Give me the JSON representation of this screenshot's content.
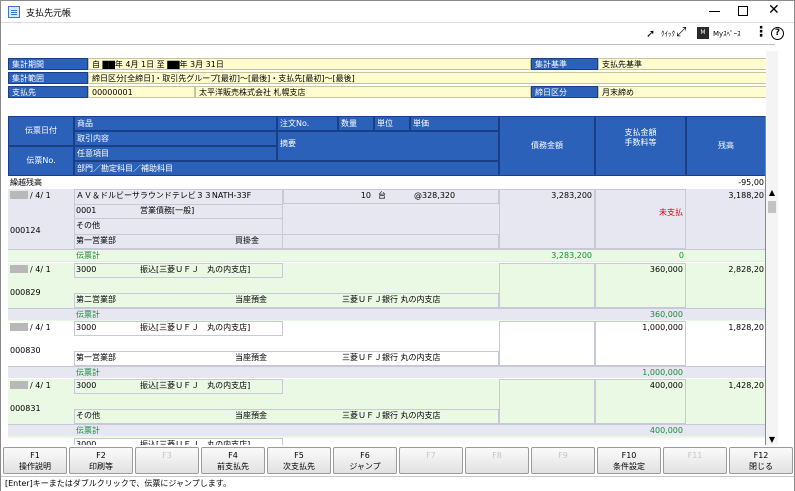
{
  "window": {
    "title": "支払先元帳"
  },
  "toolbar": {
    "quick_label": "ｸｲｯｸ",
    "myspace_label": "Myｽﾍﾟｰｽ",
    "help_label": "?"
  },
  "header": {
    "period_label": "集計期間",
    "period_value": "自 ▇▇年 4月 1日 至 ▇▇年 3月 31日",
    "basis_label": "集計基準",
    "basis_value": "支払先基準",
    "range_label": "集計範囲",
    "range_value": "締日区分[全締日]・取引先グループ[最初]～[最後]・支払先[最初]～[最後]",
    "payee_label": "支払先",
    "payee_code": "00000001",
    "payee_name": "太平洋販売株式会社 札幌支店",
    "closing_label": "締日区分",
    "closing_value": "月末締め"
  },
  "columns": {
    "slip_date": "伝票日付",
    "slip_no": "伝票No.",
    "product": "商品",
    "transaction": "取引内容",
    "optional": "任意項目",
    "dept": "部門／勘定科目／補助科目",
    "order_no": "注文No.",
    "qty": "数量",
    "unit": "単位",
    "unit_price": "単価",
    "memo": "摘要",
    "debt": "債務金額",
    "pay_line1": "支払金額",
    "pay_line2": "手数料等",
    "balance": "残高"
  },
  "carry": {
    "label": "繰越残高",
    "balance": "-95,00"
  },
  "subtotal_label": "伝票計",
  "unpaid_label": "未支払",
  "entries": [
    {
      "date": "/ 4/ 1",
      "slip_no": "000124",
      "product": "ＡＶ＆ドルビーサラウンドテレビ３３NATH-33F",
      "qty": "10",
      "unit": "台",
      "price": "@328,320",
      "code": "0001",
      "transaction": "営業債務[一般]",
      "optional": "その他",
      "dept": "第一営業部",
      "account": "買掛金",
      "sub_account": "",
      "debt": "3,283,200",
      "payment": "",
      "balance": "3,188,20",
      "sub_debt": "3,283,200",
      "sub_pay": "0"
    },
    {
      "date": "/ 4/ 1",
      "slip_no": "000829",
      "code": "3000",
      "transaction": "振込[三菱ＵＦＪ　丸の内支店]",
      "dept": "第二営業部",
      "account": "当座預金",
      "sub_account": "三菱ＵＦＪ銀行 丸の内支店",
      "payment": "360,000",
      "balance": "2,828,20",
      "sub_pay": "360,000"
    },
    {
      "date": "/ 4/ 1",
      "slip_no": "000830",
      "code": "3000",
      "transaction": "振込[三菱ＵＦＪ　丸の内支店]",
      "dept": "第一営業部",
      "account": "当座預金",
      "sub_account": "三菱ＵＦＪ銀行 丸の内支店",
      "payment": "1,000,000",
      "balance": "1,828,20",
      "sub_pay": "1,000,000"
    },
    {
      "date": "/ 4/ 1",
      "slip_no": "000831",
      "code": "3000",
      "transaction": "振込[三菱ＵＦＪ　丸の内支店]",
      "dept": "その他",
      "account": "当座預金",
      "sub_account": "三菱ＵＦＪ銀行 丸の内支店",
      "payment": "400,000",
      "balance": "1,428,20",
      "sub_pay": "400,000"
    },
    {
      "code": "3000",
      "transaction": "振込[三菱ＵＦＪ　丸の内支店]"
    }
  ],
  "fkeys": [
    {
      "key": "F1",
      "label": "操作説明",
      "enabled": true
    },
    {
      "key": "F2",
      "label": "印刷等",
      "enabled": true
    },
    {
      "key": "F3",
      "label": "",
      "enabled": false
    },
    {
      "key": "F4",
      "label": "前支払先",
      "enabled": true
    },
    {
      "key": "F5",
      "label": "次支払先",
      "enabled": true
    },
    {
      "key": "F6",
      "label": "ジャンプ",
      "enabled": true
    },
    {
      "key": "F7",
      "label": "",
      "enabled": false
    },
    {
      "key": "F8",
      "label": "",
      "enabled": false
    },
    {
      "key": "F9",
      "label": "",
      "enabled": false
    },
    {
      "key": "F10",
      "label": "条件設定",
      "enabled": true
    },
    {
      "key": "F11",
      "label": "",
      "enabled": false
    },
    {
      "key": "F12",
      "label": "閉じる",
      "enabled": true
    }
  ],
  "status": "[Enter]キーまたはダブルクリックで、伝票にジャンプします。"
}
